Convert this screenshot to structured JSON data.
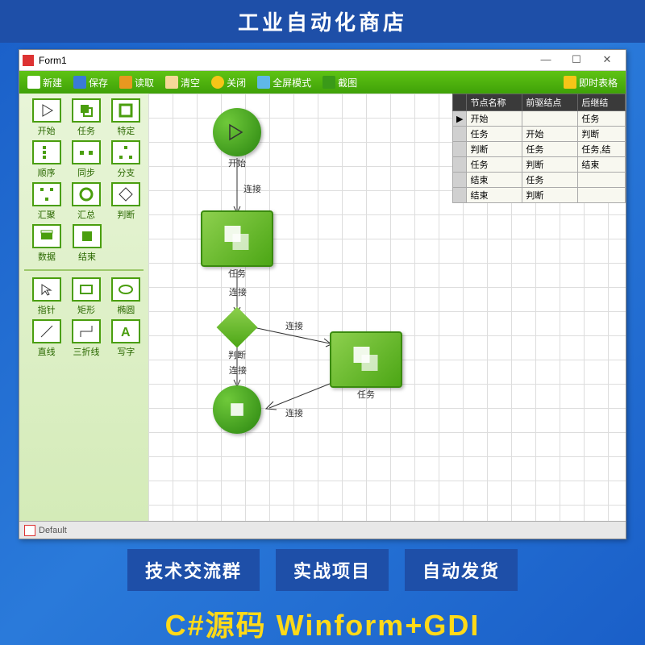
{
  "banner": "工业自动化商店",
  "window": {
    "title": "Form1"
  },
  "toolbar": [
    {
      "label": "新建"
    },
    {
      "label": "保存"
    },
    {
      "label": "读取"
    },
    {
      "label": "清空"
    },
    {
      "label": "关闭"
    },
    {
      "label": "全屏模式"
    },
    {
      "label": "截图"
    },
    {
      "label": "即时表格"
    }
  ],
  "palette": {
    "group1": [
      [
        {
          "label": "开始"
        },
        {
          "label": "任务"
        },
        {
          "label": "特定"
        }
      ],
      [
        {
          "label": "顺序"
        },
        {
          "label": "同步"
        },
        {
          "label": "分支"
        }
      ],
      [
        {
          "label": "汇聚"
        },
        {
          "label": "汇总"
        },
        {
          "label": "判断"
        }
      ],
      [
        {
          "label": "数据"
        },
        {
          "label": "结束"
        }
      ]
    ],
    "group2": [
      [
        {
          "label": "指针"
        },
        {
          "label": "矩形"
        },
        {
          "label": "椭圆"
        }
      ],
      [
        {
          "label": "直线"
        },
        {
          "label": "三折线"
        },
        {
          "label": "写字"
        }
      ]
    ]
  },
  "flow": {
    "nodes": {
      "start": "开始",
      "task1": "任务",
      "judge": "判断",
      "task2": "任务",
      "end_label": ""
    },
    "edges": {
      "e1": "连接",
      "e2": "连接",
      "e3": "连接",
      "e4": "连接",
      "e5": "连接"
    }
  },
  "table": {
    "headers": [
      "节点名称",
      "前驱结点",
      "后继结"
    ],
    "rows": [
      [
        "开始",
        "",
        "任务"
      ],
      [
        "任务",
        "开始",
        "判断"
      ],
      [
        "判断",
        "任务",
        "任务,结"
      ],
      [
        "任务",
        "判断",
        "结束"
      ],
      [
        "结束",
        "任务",
        ""
      ],
      [
        "结束",
        "判断",
        ""
      ]
    ]
  },
  "status": "Default",
  "tags": [
    "技术交流群",
    "实战项目",
    "自动发货"
  ],
  "footer": "C#源码 Winform+GDI"
}
